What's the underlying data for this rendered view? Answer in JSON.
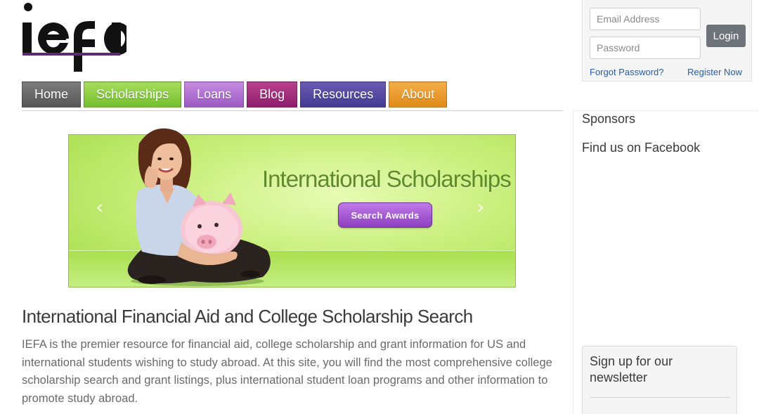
{
  "brand": {
    "logo_text": "iefa",
    "accent_color": "#5a2a73"
  },
  "login": {
    "email_placeholder": "Email Address",
    "password_placeholder": "Password",
    "login_label": "Login",
    "forgot_label": "Forgot Password?",
    "register_label": "Register Now"
  },
  "nav": {
    "items": [
      {
        "label": "Home",
        "color": "#666666"
      },
      {
        "label": "Scholarships",
        "color": "#8cce45"
      },
      {
        "label": "Loans",
        "color": "#b173d3"
      },
      {
        "label": "Blog",
        "color": "#a2317d"
      },
      {
        "label": "Resources",
        "color": "#584aa3"
      },
      {
        "label": "About",
        "color": "#eb9c2f"
      }
    ]
  },
  "banner": {
    "title": "International Scholarships",
    "button_label": "Search Awards",
    "prev_icon": "chevron-left-icon",
    "next_icon": "chevron-right-icon"
  },
  "sidebar": {
    "sponsors": "Sponsors",
    "facebook": "Find us on Facebook",
    "newsletter_title": "Sign up for our newsletter"
  },
  "main": {
    "heading": "International Financial Aid and College Scholarship Search",
    "paragraph": "IEFA is the premier resource for financial aid, college scholarship and grant information for US and international students wishing to study abroad. At this site, you will find the most comprehensive college scholarship search and grant listings, plus international student loan programs and other information to promote study abroad."
  }
}
